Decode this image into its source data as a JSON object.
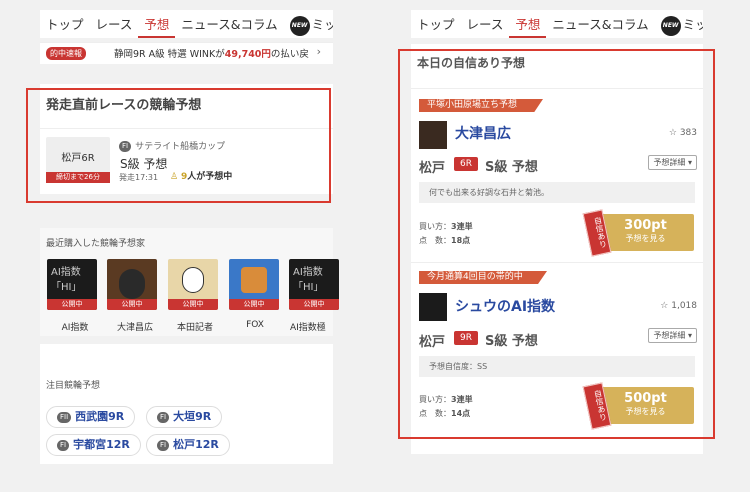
{
  "nav": {
    "items": [
      "トップ",
      "レース",
      "予想",
      "ニュース&コラム"
    ],
    "new_badge": "NEW",
    "extra": "ミッドナイ"
  },
  "left": {
    "ticker": {
      "badge": "的中速報",
      "text_pre": "静岡9R A級 特選 WINKが",
      "amount": "49,740円",
      "text_post": "の払い戻"
    },
    "section_title": "発走直前レースの競輪予想",
    "race": {
      "venue_race": "松戸6R",
      "deadline": "締切まで26分",
      "grade": "FI",
      "cup": "サテライト船橋カップ",
      "title": "S級 予想",
      "start": "発走17:31",
      "count": "9",
      "count_text": "人が予想中"
    },
    "recent_title": "最近購入した競輪予想家",
    "experts": [
      {
        "name": "AI指数",
        "status": "公開中"
      },
      {
        "name": "大津昌広",
        "status": "公開中"
      },
      {
        "name": "本田記者",
        "status": "公開中"
      },
      {
        "name": "FOX",
        "status": "公開中"
      },
      {
        "name": "AI指数極",
        "status": "公開中"
      }
    ],
    "featured_title": "注目競輪予想",
    "featured": [
      {
        "grade": "FII",
        "label": "西武園9R"
      },
      {
        "grade": "FI",
        "label": "大垣9R"
      },
      {
        "grade": "FI",
        "label": "宇都宮12R"
      },
      {
        "grade": "FI",
        "label": "松戸12R"
      }
    ]
  },
  "right": {
    "section_title": "本日の自信あり予想",
    "cards": [
      {
        "banner": "平塚小田原場立ち予想",
        "name": "大津昌広",
        "likes": "☆ 383",
        "venue": "松戸",
        "race": "6R",
        "title": "S級 予想",
        "detail": "予想詳細 ▾",
        "comment": "何でも出来る好調な石井と菊池。",
        "buy_label": "買い方：",
        "buy": "3連単",
        "points_label": "点　数：",
        "points": "18点",
        "price": "300pt",
        "cta": "予想を見る",
        "stamp": "自信あり"
      },
      {
        "banner": "今月通算4回目の帯的中",
        "name": "シュウのAI指数",
        "likes": "☆ 1,018",
        "venue": "松戸",
        "race": "9R",
        "title": "S級 予想",
        "detail": "予想詳細 ▾",
        "comment": "予想自信度：SS",
        "buy_label": "買い方：",
        "buy": "3連単",
        "points_label": "点　数：",
        "points": "14点",
        "price": "500pt",
        "cta": "予想を見る",
        "stamp": "自信あり"
      }
    ]
  },
  "colors": {
    "accent": "#c93532",
    "gold": "#d6b25a",
    "frame": "#d93a2f",
    "link": "#2a4aa0"
  }
}
